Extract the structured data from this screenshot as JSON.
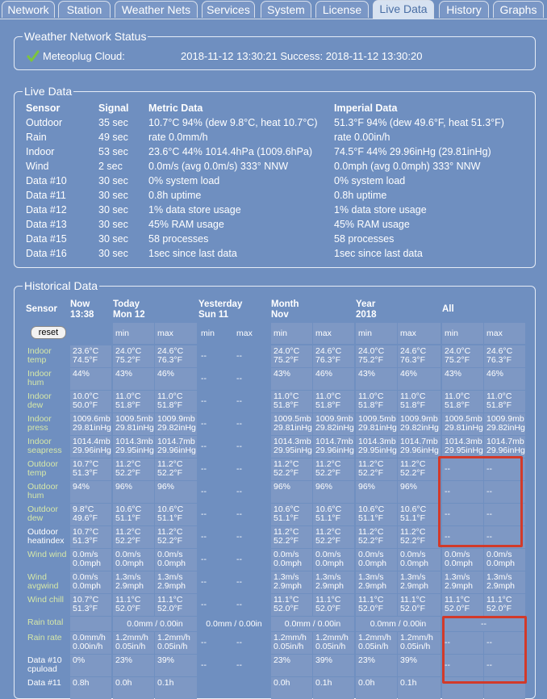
{
  "tabs": [
    "Network",
    "Station",
    "Weather Nets",
    "Services",
    "System",
    "License",
    "Live Data",
    "History",
    "Graphs"
  ],
  "weather_status": {
    "legend": "Weather Network Status",
    "service": "Meteoplug Cloud:",
    "status": "2018-11-12 13:30:21 Success: 2018-11-12 13:30:20"
  },
  "live": {
    "legend": "Live Data",
    "headers": [
      "Sensor",
      "Signal",
      "Metric Data",
      "Imperial Data"
    ],
    "rows": [
      [
        "Outdoor",
        "35 sec",
        "10.7°C 94% (dew 9.8°C, heat 10.7°C)",
        "51.3°F 94% (dew 49.6°F, heat 51.3°F)"
      ],
      [
        "Rain",
        "49 sec",
        "rate 0.0mm/h",
        "rate 0.00in/h"
      ],
      [
        "Indoor",
        "53 sec",
        "23.6°C 44% 1014.4hPa (1009.6hPa)",
        "74.5°F 44% 29.96inHg (29.81inHg)"
      ],
      [
        "Wind",
        "2 sec",
        "0.0m/s (avg 0.0m/s) 333° NNW",
        "0.0mph (avg 0.0mph) 333° NNW"
      ],
      [
        "Data #10",
        "30 sec",
        "0% system load",
        "0% system load"
      ],
      [
        "Data #11",
        "30 sec",
        "0.8h uptime",
        "0.8h uptime"
      ],
      [
        "Data #12",
        "30 sec",
        "1% data store usage",
        "1% data store usage"
      ],
      [
        "Data #13",
        "30 sec",
        "45% RAM usage",
        "45% RAM usage"
      ],
      [
        "Data #15",
        "30 sec",
        "58 processes",
        "58 processes"
      ],
      [
        "Data #16",
        "30 sec",
        "1sec since last data",
        "1sec since last data"
      ]
    ]
  },
  "hist": {
    "legend": "Historical Data",
    "sensor_header": "Sensor",
    "col_headers": [
      [
        "Now",
        "13:38"
      ],
      [
        "Today",
        "Mon 12"
      ],
      [
        "Yesterday",
        "Sun 11"
      ],
      [
        "Month",
        "Nov"
      ],
      [
        "Year",
        "2018"
      ],
      [
        "All",
        ""
      ]
    ],
    "reset_label": "reset",
    "min_label": "min",
    "max_label": "max",
    "rows": [
      {
        "label": [
          "Indoor",
          "temp"
        ],
        "cells": [
          [
            "23.6°C",
            "74.5°F"
          ],
          [
            "24.0°C",
            "75.2°F"
          ],
          [
            "24.6°C",
            "76.3°F"
          ],
          [
            "--",
            ""
          ],
          [
            "--",
            ""
          ],
          [
            "24.0°C",
            "75.2°F"
          ],
          [
            "24.6°C",
            "76.3°F"
          ],
          [
            "24.0°C",
            "75.2°F"
          ],
          [
            "24.6°C",
            "76.3°F"
          ],
          [
            "24.0°C",
            "75.2°F"
          ],
          [
            "24.6°C",
            "76.3°F"
          ]
        ]
      },
      {
        "label": [
          "Indoor",
          "hum"
        ],
        "cells": [
          [
            "44%",
            ""
          ],
          [
            "43%",
            ""
          ],
          [
            "46%",
            ""
          ],
          [
            "--",
            ""
          ],
          [
            "--",
            ""
          ],
          [
            "43%",
            ""
          ],
          [
            "46%",
            ""
          ],
          [
            "43%",
            ""
          ],
          [
            "46%",
            ""
          ],
          [
            "43%",
            ""
          ],
          [
            "46%",
            ""
          ]
        ]
      },
      {
        "label": [
          "Indoor",
          "dew"
        ],
        "cells": [
          [
            "10.0°C",
            "50.0°F"
          ],
          [
            "11.0°C",
            "51.8°F"
          ],
          [
            "11.0°C",
            "51.8°F"
          ],
          [
            "--",
            ""
          ],
          [
            "--",
            ""
          ],
          [
            "11.0°C",
            "51.8°F"
          ],
          [
            "11.0°C",
            "51.8°F"
          ],
          [
            "11.0°C",
            "51.8°F"
          ],
          [
            "11.0°C",
            "51.8°F"
          ],
          [
            "11.0°C",
            "51.8°F"
          ],
          [
            "11.0°C",
            "51.8°F"
          ]
        ]
      },
      {
        "label": [
          "Indoor",
          "press"
        ],
        "cells": [
          [
            "1009.6mb",
            "29.81inHg"
          ],
          [
            "1009.5mb",
            "29.81inHg"
          ],
          [
            "1009.9mb",
            "29.82inHg"
          ],
          [
            "--",
            ""
          ],
          [
            "--",
            ""
          ],
          [
            "1009.5mb",
            "29.81inHg"
          ],
          [
            "1009.9mb",
            "29.82inHg"
          ],
          [
            "1009.5mb",
            "29.81inHg"
          ],
          [
            "1009.9mb",
            "29.82inHg"
          ],
          [
            "1009.5mb",
            "29.81inHg"
          ],
          [
            "1009.9mb",
            "29.82inHg"
          ]
        ]
      },
      {
        "label": [
          "Indoor",
          "seapress"
        ],
        "cells": [
          [
            "1014.4mb",
            "29.96inHg"
          ],
          [
            "1014.3mb",
            "29.95inHg"
          ],
          [
            "1014.7mb",
            "29.96inHg"
          ],
          [
            "--",
            ""
          ],
          [
            "--",
            ""
          ],
          [
            "1014.3mb",
            "29.95inHg"
          ],
          [
            "1014.7mb",
            "29.96inHg"
          ],
          [
            "1014.3mb",
            "29.95inHg"
          ],
          [
            "1014.7mb",
            "29.96inHg"
          ],
          [
            "1014.3mb",
            "29.95inHg"
          ],
          [
            "1014.7mb",
            "29.96inHg"
          ]
        ]
      },
      {
        "label": [
          "Outdoor",
          "temp"
        ],
        "cells": [
          [
            "10.7°C",
            "51.3°F"
          ],
          [
            "11.2°C",
            "52.2°F"
          ],
          [
            "11.2°C",
            "52.2°F"
          ],
          [
            "--",
            ""
          ],
          [
            "--",
            ""
          ],
          [
            "11.2°C",
            "52.2°F"
          ],
          [
            "11.2°C",
            "52.2°F"
          ],
          [
            "11.2°C",
            "52.2°F"
          ],
          [
            "11.2°C",
            "52.2°F"
          ],
          [
            "--",
            ""
          ],
          [
            "--",
            ""
          ]
        ]
      },
      {
        "label": [
          "Outdoor",
          "hum"
        ],
        "cells": [
          [
            "94%",
            ""
          ],
          [
            "96%",
            ""
          ],
          [
            "96%",
            ""
          ],
          [
            "--",
            ""
          ],
          [
            "--",
            ""
          ],
          [
            "96%",
            ""
          ],
          [
            "96%",
            ""
          ],
          [
            "96%",
            ""
          ],
          [
            "96%",
            ""
          ],
          [
            "--",
            ""
          ],
          [
            "--",
            ""
          ]
        ]
      },
      {
        "label": [
          "Outdoor",
          "dew"
        ],
        "cells": [
          [
            "9.8°C",
            "49.6°F"
          ],
          [
            "10.6°C",
            "51.1°F"
          ],
          [
            "10.6°C",
            "51.1°F"
          ],
          [
            "--",
            ""
          ],
          [
            "--",
            ""
          ],
          [
            "10.6°C",
            "51.1°F"
          ],
          [
            "10.6°C",
            "51.1°F"
          ],
          [
            "10.6°C",
            "51.1°F"
          ],
          [
            "10.6°C",
            "51.1°F"
          ],
          [
            "--",
            ""
          ],
          [
            "--",
            ""
          ]
        ]
      },
      {
        "label": [
          "Outdoor",
          "heatindex"
        ],
        "white": true,
        "cells": [
          [
            "10.7°C",
            "51.3°F"
          ],
          [
            "11.2°C",
            "52.2°F"
          ],
          [
            "11.2°C",
            "52.2°F"
          ],
          [
            "--",
            ""
          ],
          [
            "--",
            ""
          ],
          [
            "11.2°C",
            "52.2°F"
          ],
          [
            "11.2°C",
            "52.2°F"
          ],
          [
            "11.2°C",
            "52.2°F"
          ],
          [
            "11.2°C",
            "52.2°F"
          ],
          [
            "--",
            ""
          ],
          [
            "--",
            ""
          ]
        ]
      },
      {
        "label": [
          "Wind wind",
          ""
        ],
        "cells": [
          [
            "0.0m/s",
            "0.0mph"
          ],
          [
            "0.0m/s",
            "0.0mph"
          ],
          [
            "0.0m/s",
            "0.0mph"
          ],
          [
            "--",
            ""
          ],
          [
            "--",
            ""
          ],
          [
            "0.0m/s",
            "0.0mph"
          ],
          [
            "0.0m/s",
            "0.0mph"
          ],
          [
            "0.0m/s",
            "0.0mph"
          ],
          [
            "0.0m/s",
            "0.0mph"
          ],
          [
            "0.0m/s",
            "0.0mph"
          ],
          [
            "0.0m/s",
            "0.0mph"
          ]
        ]
      },
      {
        "label": [
          "Wind",
          "avgwind"
        ],
        "cells": [
          [
            "0.0m/s",
            "0.0mph"
          ],
          [
            "1.3m/s",
            "2.9mph"
          ],
          [
            "1.3m/s",
            "2.9mph"
          ],
          [
            "--",
            ""
          ],
          [
            "--",
            ""
          ],
          [
            "1.3m/s",
            "2.9mph"
          ],
          [
            "1.3m/s",
            "2.9mph"
          ],
          [
            "1.3m/s",
            "2.9mph"
          ],
          [
            "1.3m/s",
            "2.9mph"
          ],
          [
            "1.3m/s",
            "2.9mph"
          ],
          [
            "1.3m/s",
            "2.9mph"
          ]
        ]
      },
      {
        "label": [
          "Wind chill",
          ""
        ],
        "cells": [
          [
            "10.7°C",
            "51.3°F"
          ],
          [
            "11.1°C",
            "52.0°F"
          ],
          [
            "11.1°C",
            "52.0°F"
          ],
          [
            "--",
            ""
          ],
          [
            "--",
            ""
          ],
          [
            "11.1°C",
            "52.0°F"
          ],
          [
            "11.1°C",
            "52.0°F"
          ],
          [
            "11.1°C",
            "52.0°F"
          ],
          [
            "11.1°C",
            "52.0°F"
          ],
          [
            "11.1°C",
            "52.0°F"
          ],
          [
            "11.1°C",
            "52.0°F"
          ]
        ]
      }
    ],
    "rain_total": {
      "label": "Rain total",
      "today": "0.0mm / 0.00in",
      "yesterday": "0.0mm / 0.00in",
      "month": "0.0mm / 0.00in",
      "year": "0.0mm / 0.00in",
      "all": "--"
    },
    "rain_rate": {
      "label": "Rain rate",
      "cells": [
        [
          "0.0mm/h",
          "0.00in/h"
        ],
        [
          "1.2mm/h",
          "0.05in/h"
        ],
        [
          "1.2mm/h",
          "0.05in/h"
        ],
        [
          "--",
          ""
        ],
        [
          "--",
          ""
        ],
        [
          "1.2mm/h",
          "0.05in/h"
        ],
        [
          "1.2mm/h",
          "0.05in/h"
        ],
        [
          "1.2mm/h",
          "0.05in/h"
        ],
        [
          "1.2mm/h",
          "0.05in/h"
        ],
        [
          "--",
          ""
        ],
        [
          "--",
          ""
        ]
      ]
    },
    "data10": {
      "label": [
        "Data #10",
        "cpuload"
      ],
      "cells": [
        [
          "0%",
          ""
        ],
        [
          "23%",
          ""
        ],
        [
          "39%",
          ""
        ],
        [
          "--",
          ""
        ],
        [
          "--",
          ""
        ],
        [
          "23%",
          ""
        ],
        [
          "39%",
          ""
        ],
        [
          "23%",
          ""
        ],
        [
          "39%",
          ""
        ],
        [
          "--",
          ""
        ],
        [
          "--",
          ""
        ]
      ]
    },
    "data11": {
      "label": [
        "Data #11",
        ""
      ],
      "cells": [
        [
          "0.8h",
          ""
        ],
        [
          "0.0h",
          ""
        ],
        [
          "0.1h",
          ""
        ],
        [
          "",
          ""
        ],
        [
          "",
          ""
        ],
        [
          "0.0h",
          ""
        ],
        [
          "0.1h",
          ""
        ],
        [
          "0.0h",
          ""
        ],
        [
          "0.1h",
          ""
        ],
        [
          "",
          ""
        ],
        [
          "",
          ""
        ]
      ]
    }
  },
  "colors": {
    "background": "#6f8fc0",
    "cell": "#7e98c4",
    "label_green": "#d6e8a8",
    "highlight_red": "#d23a2a"
  }
}
